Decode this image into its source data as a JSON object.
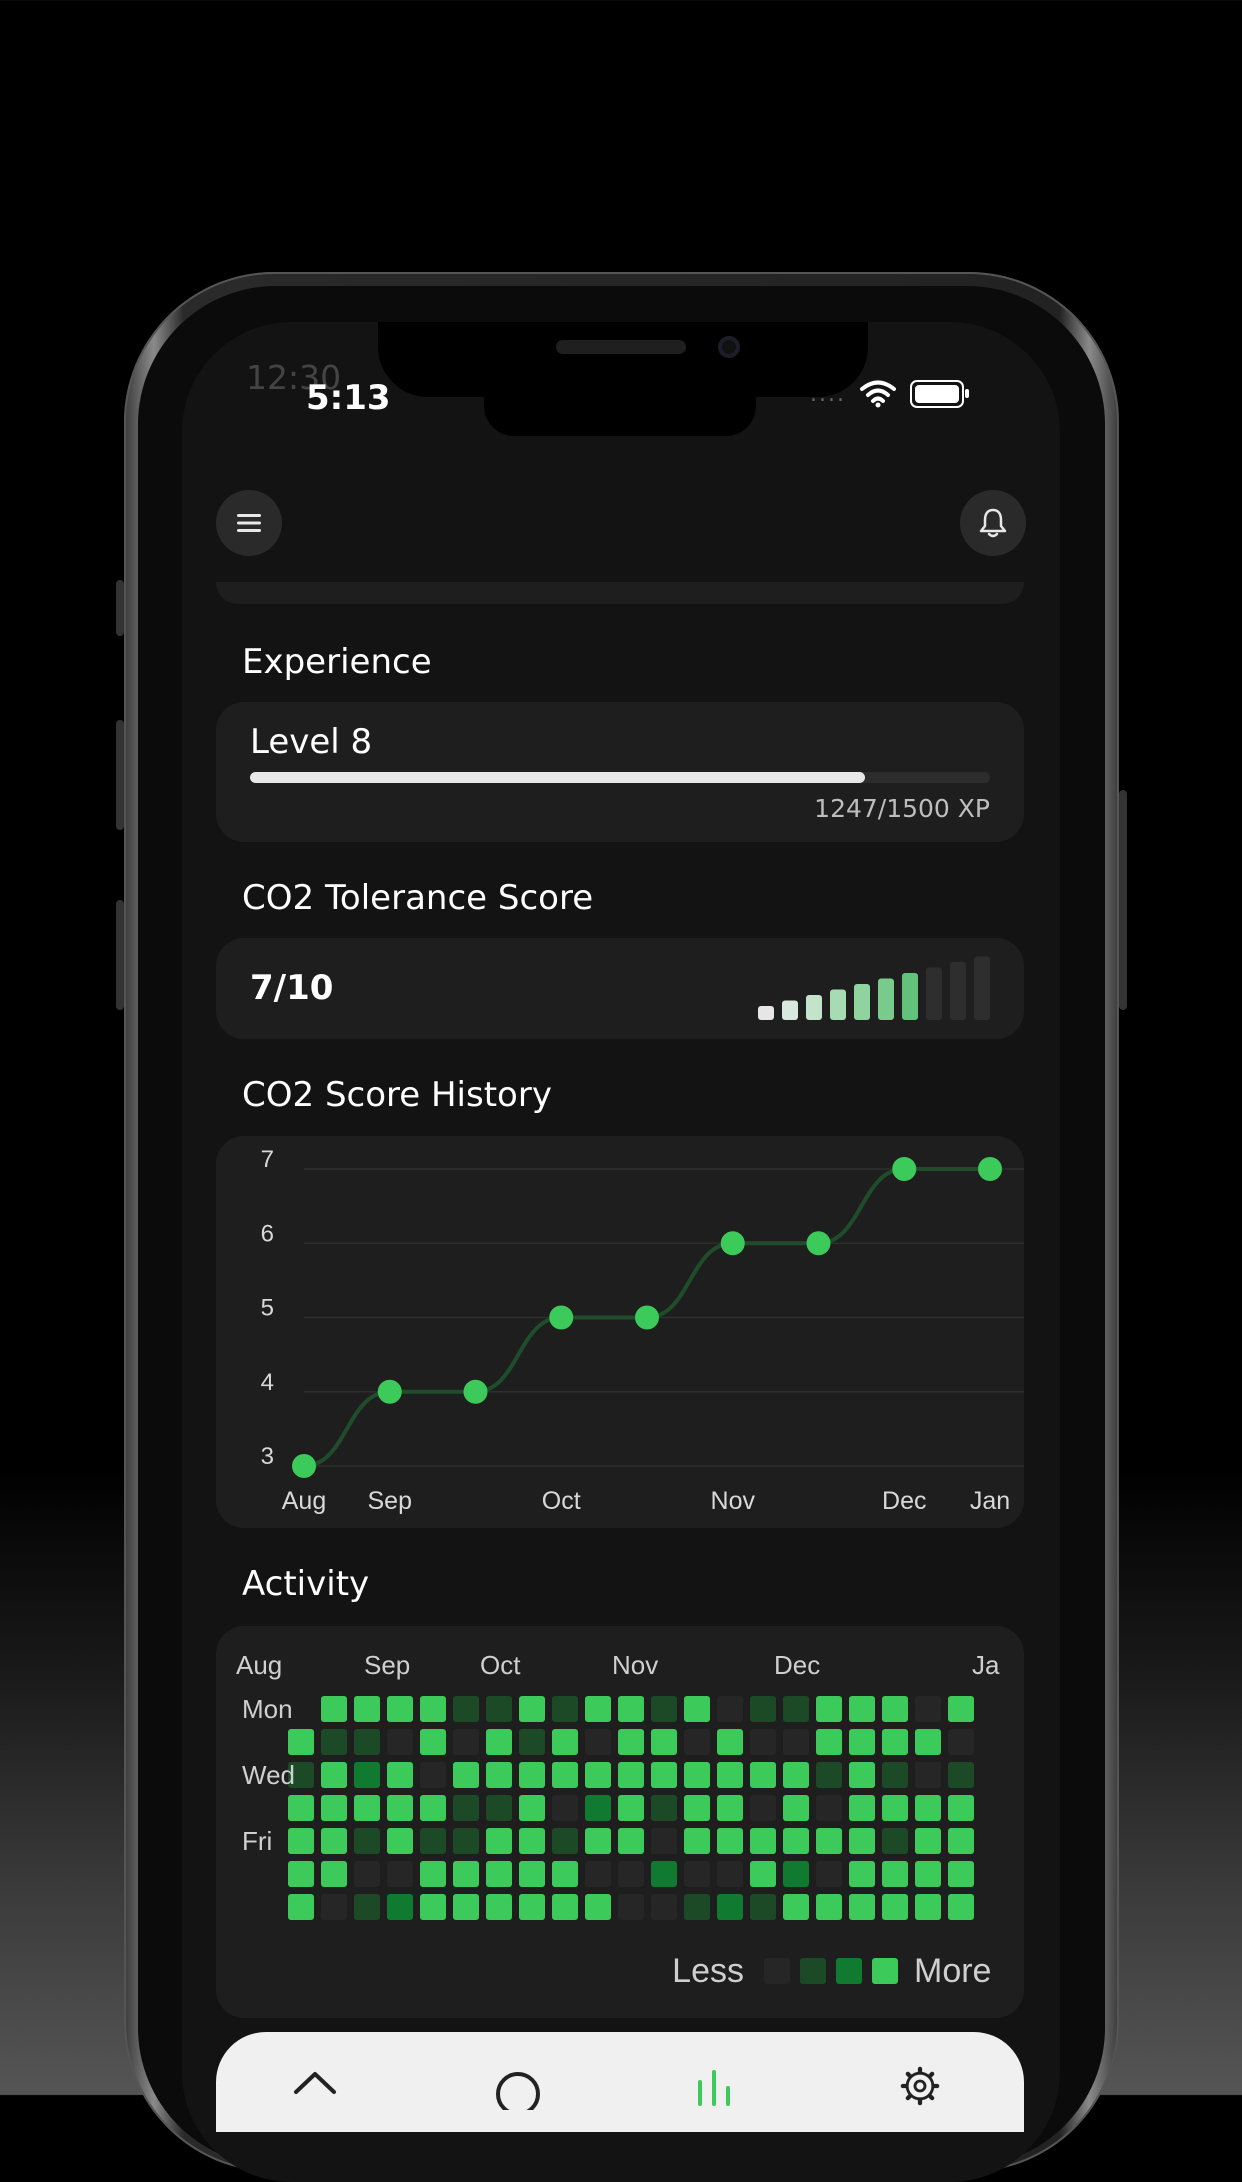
{
  "status_bar": {
    "ghost_time": "12:30",
    "time": "5:13",
    "signal_dots": "....",
    "wifi_icon": "wifi-icon",
    "battery_icon": "battery-icon"
  },
  "header": {
    "menu_icon": "menu-icon",
    "bell_icon": "bell-icon"
  },
  "experience": {
    "title": "Experience",
    "level_label": "Level 8",
    "xp_current": 1247,
    "xp_max": 1500,
    "xp_text": "1247/1500 XP"
  },
  "co2_score": {
    "title": "CO2 Tolerance Score",
    "value_text": "7/10",
    "score": 7,
    "max": 10
  },
  "history": {
    "title": "CO2 Score History"
  },
  "chart_data": {
    "type": "line",
    "x": [
      "Aug",
      "Sep",
      "Sep",
      "Oct",
      "Oct",
      "Nov",
      "Nov",
      "Dec",
      "Jan"
    ],
    "x_tick_labels": [
      "Aug",
      "Sep",
      "Oct",
      "Nov",
      "Dec",
      "Jan"
    ],
    "values": [
      3,
      4,
      4,
      5,
      5,
      6,
      6,
      7,
      7
    ],
    "y_ticks": [
      7,
      6,
      5,
      4,
      3
    ],
    "ylim": [
      3,
      7
    ],
    "grid": true,
    "line_color": "#1f4d2c",
    "point_color": "#3ccb5a"
  },
  "activity": {
    "title": "Activity",
    "months": [
      "Aug",
      "Sep",
      "Oct",
      "Nov",
      "Dec",
      "Ja"
    ],
    "days": [
      "Mon",
      "Wed",
      "Fri"
    ],
    "legend_less": "Less",
    "legend_more": "More",
    "levels": [
      "#262626",
      "#1c4a27",
      "#0f7a30",
      "#3ccb5a"
    ],
    "grid": [
      [
        3,
        3,
        3,
        3,
        1,
        1,
        3,
        1,
        3,
        3,
        1,
        3,
        0,
        1,
        1,
        3,
        3,
        3,
        0,
        3
      ],
      [
        3,
        1,
        1,
        0,
        3,
        0,
        3,
        1,
        3,
        0,
        3,
        3,
        0,
        3,
        0,
        0,
        3,
        3,
        3,
        3,
        0
      ],
      [
        1,
        3,
        2,
        3,
        0,
        3,
        3,
        3,
        3,
        3,
        3,
        3,
        3,
        3,
        3,
        3,
        1,
        3,
        1,
        0,
        1
      ],
      [
        3,
        3,
        3,
        3,
        3,
        1,
        1,
        3,
        0,
        2,
        3,
        1,
        3,
        3,
        0,
        3,
        0,
        3,
        3,
        3,
        3
      ],
      [
        3,
        3,
        1,
        3,
        1,
        1,
        3,
        3,
        1,
        3,
        3,
        0,
        3,
        3,
        3,
        3,
        3,
        3,
        1,
        3,
        3
      ],
      [
        3,
        3,
        0,
        0,
        3,
        3,
        3,
        3,
        3,
        0,
        0,
        2,
        0,
        0,
        3,
        2,
        0,
        3,
        3,
        3,
        3
      ],
      [
        3,
        0,
        1,
        2,
        3,
        3,
        3,
        3,
        3,
        3,
        0,
        0,
        1,
        2,
        1,
        3,
        3,
        3,
        3,
        3,
        3
      ]
    ]
  },
  "bottom_nav": {
    "items": [
      {
        "icon": "home-icon"
      },
      {
        "icon": "search-icon"
      },
      {
        "icon": "stats-icon"
      },
      {
        "icon": "gear-icon"
      }
    ],
    "active_color": "#3ccb5a"
  }
}
